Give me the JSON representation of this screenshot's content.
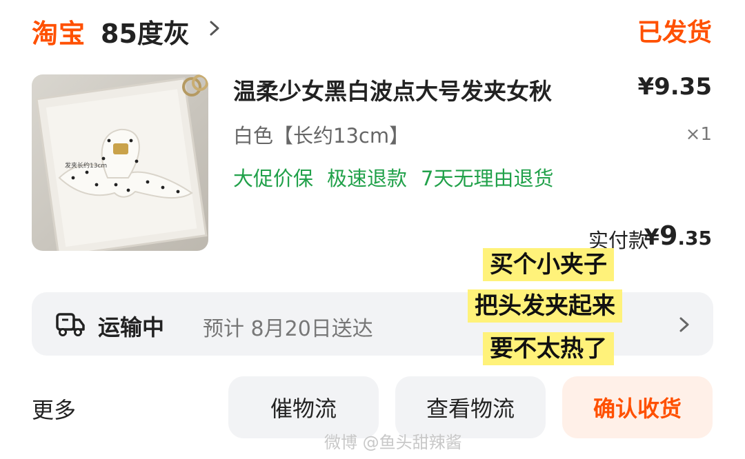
{
  "header": {
    "brand": "淘宝",
    "shop_name": "85度灰",
    "order_status": "已发货",
    "chevron_icon": "chevron-right-icon"
  },
  "product": {
    "title": "温柔少女黑白波点大号发夹女秋",
    "price": "¥9.35",
    "spec": "白色【长约13cm】",
    "quantity": "×1",
    "tags": [
      "大促价保",
      "极速退款",
      "7天无理由退货"
    ],
    "image_caption": "发夹长约13cm",
    "paid_label": "实付款",
    "paid_yen": "¥",
    "paid_int": "9",
    "paid_dec": ".35"
  },
  "shipping": {
    "status": "运输中",
    "eta": "预计 8月20日送达",
    "icon": "truck-icon"
  },
  "overlay_notes": [
    "买个小夹子",
    "把头发夹起来",
    "要不太热了"
  ],
  "actions": {
    "more": "更多",
    "urge_logistics": "催物流",
    "view_logistics": "查看物流",
    "confirm_receipt": "确认收货"
  },
  "watermark": "微博 @鱼头甜辣酱",
  "colors": {
    "brand_orange": "#ff5000",
    "tag_green": "#21a14a",
    "card_bg": "#f2f3f5",
    "highlight_yellow": "#fff27a"
  }
}
